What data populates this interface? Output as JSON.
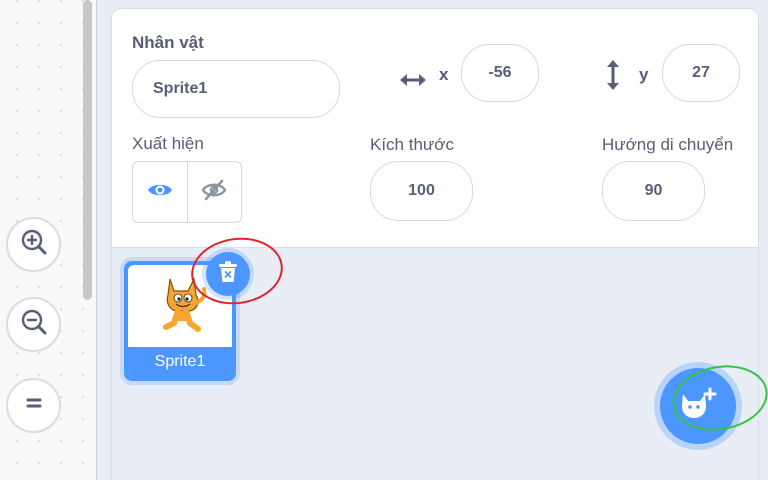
{
  "code_area": {
    "zoom_in": "zoom-in-icon",
    "zoom_out": "zoom-out-icon",
    "zoom_reset": "equals-icon"
  },
  "sprite_info": {
    "name_label": "Nhân vật",
    "name_value": "Sprite1",
    "x_label": "x",
    "x_value": "-56",
    "y_label": "y",
    "y_value": "27",
    "show_label": "Xuất hiện",
    "size_label": "Kích thước",
    "size_value": "100",
    "direction_label": "Hướng di chuyển",
    "direction_value": "90"
  },
  "sprite_list": {
    "sprites": [
      {
        "name": "Sprite1",
        "selected": true
      }
    ]
  },
  "colors": {
    "accent": "#4c97ff",
    "annotation_red": "#e0242c",
    "annotation_green": "#36c24a"
  }
}
